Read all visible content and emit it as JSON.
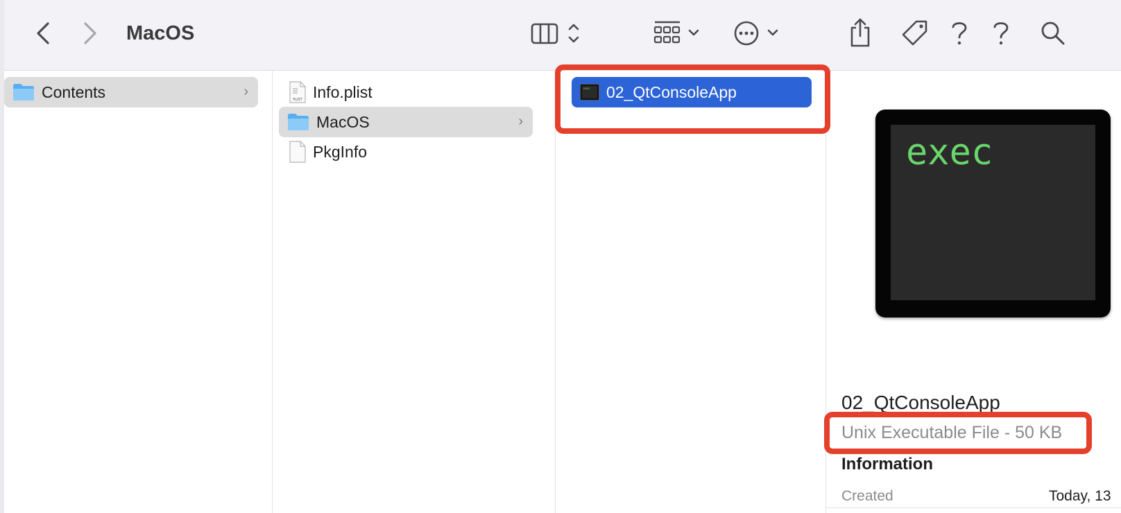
{
  "window": {
    "title": "MacOS"
  },
  "toolbar": {
    "back_icon": "chevron-left-icon",
    "forward_icon": "chevron-right-icon",
    "view_icon": "column-view-icon",
    "group_icon": "group-grid-icon",
    "action_icon": "ellipsis-circle-icon",
    "share_icon": "share-icon",
    "tag_icon": "tag-icon",
    "help_icon": "question-icon",
    "search_icon": "search-icon"
  },
  "columns": {
    "col1": [
      {
        "name": "Contents",
        "type": "folder",
        "selected": true
      }
    ],
    "col2": [
      {
        "name": "Info.plist",
        "type": "plist"
      },
      {
        "name": "MacOS",
        "type": "folder",
        "selected": true
      },
      {
        "name": "PkgInfo",
        "type": "file"
      }
    ],
    "col3": [
      {
        "name": "02_QtConsoleApp",
        "type": "executable",
        "selected": true
      }
    ]
  },
  "preview": {
    "icon_text": "exec",
    "name": "02_QtConsoleApp",
    "kind": "Unix Executable File - 50 KB",
    "section": "Information",
    "created_label": "Created",
    "created_value": "Today, 13"
  },
  "colors": {
    "selection_blue": "#2c63d6",
    "annotation_red": "#e5402b",
    "exec_green": "#69d66b"
  }
}
